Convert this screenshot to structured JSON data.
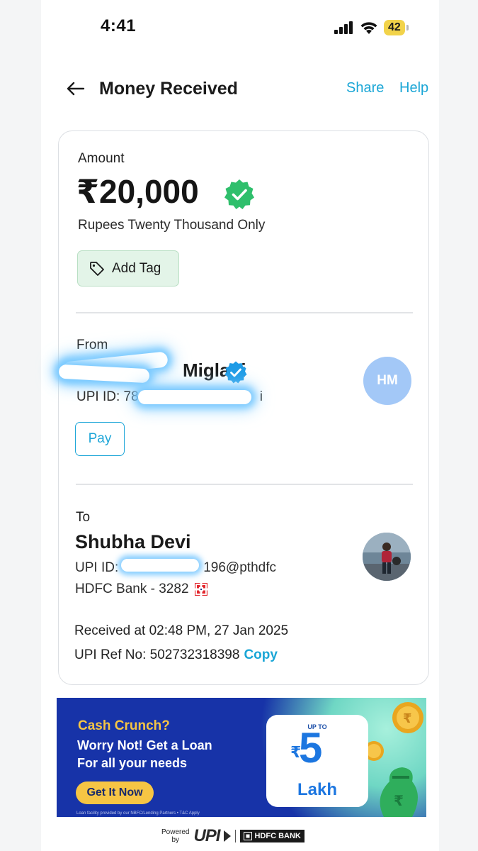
{
  "status_bar": {
    "time": "4:41",
    "battery": "42"
  },
  "header": {
    "title": "Money Received",
    "share": "Share",
    "help": "Help"
  },
  "amount": {
    "label": "Amount",
    "value": "₹20,000",
    "words": "Rupees Twenty Thousand Only",
    "add_tag": "Add Tag"
  },
  "from": {
    "label": "From",
    "name": "Miglani",
    "upi_id": "UPI ID: 7827",
    "upi_suffix": "i",
    "avatar_initials": "HM",
    "pay": "Pay"
  },
  "to": {
    "label": "To",
    "name": "Shubha Devi",
    "upi_id_prefix": "UPI ID:",
    "upi_id_suffix": "196@pthdfc",
    "bank": "HDFC Bank - 3282"
  },
  "meta": {
    "received": "Received at 02:48 PM, 27 Jan 2025",
    "ref": "UPI Ref No: 502732318398",
    "copy": "Copy"
  },
  "banner": {
    "headline": "Cash Crunch?",
    "line1": "Worry Not! Get a Loan",
    "line2": "For all your needs",
    "cta": "Get It Now",
    "fine_print": "Loan facility provided by our NBFC/Lending Partners • T&C Apply",
    "up_to": "UP TO",
    "amount": "5",
    "unit": "Lakh"
  },
  "footer": {
    "powered": "Powered",
    "by": "by",
    "upi": "UPI",
    "bank": "HDFC BANK"
  },
  "colors": {
    "accent": "#1aa6d6",
    "verified_green": "#2fbf6c",
    "verified_blue": "#1e9be6",
    "banner_bg": "#1733a8",
    "cta_yellow": "#f6c544"
  }
}
